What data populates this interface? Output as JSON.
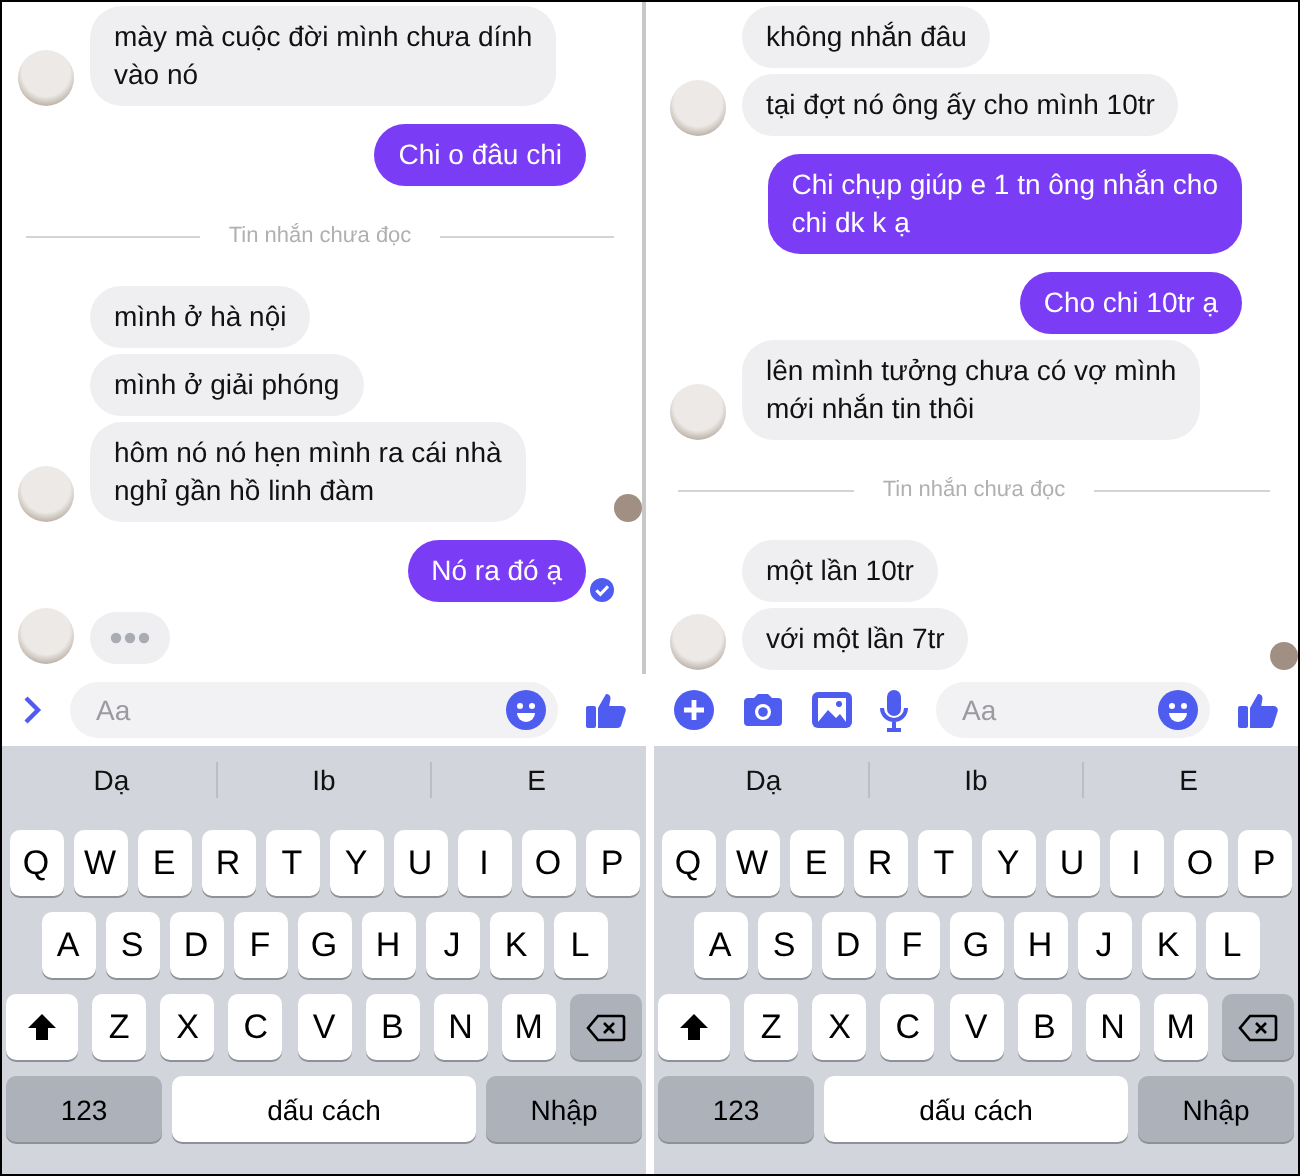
{
  "panels": [
    {
      "messages": [
        {
          "kind": "in",
          "text": "mày mà cuộc đời mình chưa dính\nvào nó",
          "avatar": true,
          "seen_by": false
        },
        {
          "kind": "out",
          "text": "Chi o đâu chi",
          "seen": false
        },
        {
          "kind": "divider",
          "text": "Tin nhắn chưa đọc"
        },
        {
          "kind": "in",
          "text": "mình ở hà nội",
          "avatar": false,
          "seen_by": false
        },
        {
          "kind": "in",
          "text": "mình ở giải phóng",
          "avatar": false,
          "seen_by": false
        },
        {
          "kind": "in",
          "text": "hôm nó nó hẹn mình ra cái nhà\nnghỉ gần hồ linh đàm",
          "avatar": true,
          "seen_by": true
        },
        {
          "kind": "out",
          "text": "Nó ra đó ạ",
          "seen": true
        },
        {
          "kind": "typing",
          "avatar": true
        }
      ],
      "composer": {
        "tools": [
          {
            "kind": "chevron"
          }
        ],
        "placeholder": "Aa"
      },
      "keyboard": {
        "suggestions": [
          "Dạ",
          "Ib",
          "E"
        ],
        "rows": [
          [
            "Q",
            "W",
            "E",
            "R",
            "T",
            "Y",
            "U",
            "I",
            "O",
            "P"
          ],
          [
            "A",
            "S",
            "D",
            "F",
            "G",
            "H",
            "J",
            "K",
            "L"
          ],
          [
            "Z",
            "X",
            "C",
            "V",
            "B",
            "N",
            "M"
          ]
        ],
        "numbers": "123",
        "space": "dấu cách",
        "enter": "Nhập"
      }
    },
    {
      "messages": [
        {
          "kind": "in",
          "text": "không nhắn đâu",
          "avatar": false,
          "seen_by": false
        },
        {
          "kind": "in",
          "text": "tại đợt nó ông ấy cho mình 10tr",
          "avatar": true,
          "seen_by": false
        },
        {
          "kind": "out",
          "text": "Chi chụp giúp e 1 tn ông nhắn cho\nchi dk k ạ",
          "seen": false
        },
        {
          "kind": "out",
          "text": "Cho chi 10tr ạ",
          "seen": false
        },
        {
          "kind": "in",
          "text": "lên mình tưởng chưa có vợ mình\nmới nhắn tin thôi",
          "avatar": true,
          "seen_by": false
        },
        {
          "kind": "divider",
          "text": "Tin nhắn chưa đọc"
        },
        {
          "kind": "in",
          "text": "một lần 10tr",
          "avatar": false,
          "seen_by": false
        },
        {
          "kind": "in",
          "text": "với một lần 7tr",
          "avatar": true,
          "seen_by": true
        }
      ],
      "composer": {
        "tools": [
          {
            "kind": "plus"
          },
          {
            "kind": "camera"
          },
          {
            "kind": "image"
          },
          {
            "kind": "mic"
          }
        ],
        "placeholder": "Aa"
      },
      "keyboard": {
        "suggestions": [
          "Dạ",
          "Ib",
          "E"
        ],
        "rows": [
          [
            "Q",
            "W",
            "E",
            "R",
            "T",
            "Y",
            "U",
            "I",
            "O",
            "P"
          ],
          [
            "A",
            "S",
            "D",
            "F",
            "G",
            "H",
            "J",
            "K",
            "L"
          ],
          [
            "Z",
            "X",
            "C",
            "V",
            "B",
            "N",
            "M"
          ]
        ],
        "numbers": "123",
        "space": "dấu cách",
        "enter": "Nhập"
      }
    }
  ]
}
